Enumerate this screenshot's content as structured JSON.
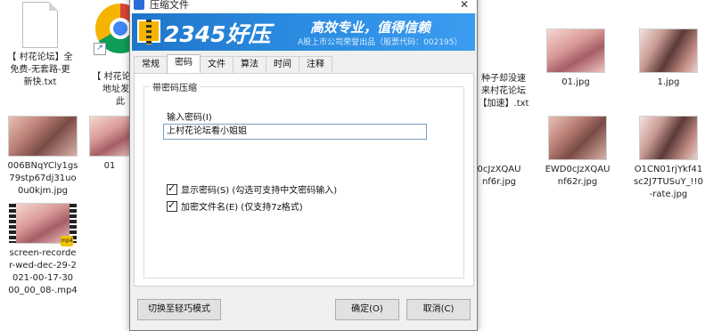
{
  "desktop": {
    "icons": [
      {
        "label": "【 村花论坛】全\n免费-无套路-更\n新快.txt"
      },
      {
        "label": "【 村花论坛】\n地址发布\n此"
      },
      {
        "label": "种子却没速\n来村花论坛\n【加速】.txt"
      },
      {
        "label": "01.jpg"
      },
      {
        "label": "1.jpg"
      },
      {
        "label": "006BNqYCly1gs\n79stp67dj31uo\n0u0kjm.jpg"
      },
      {
        "label": "01"
      },
      {
        "label": "0cJzXQAU\nnf6r.jpg"
      },
      {
        "label": "EWD0cJzXQAU\nnf62r.jpg"
      },
      {
        "label": "O1CN01rjYkf41\nsc2J7TUSuY_!!0\n-rate.jpg"
      },
      {
        "label": "screen-recorde\nr-wed-dec-29-2\n021-00-17-30\n00_00_08-.mp4"
      }
    ],
    "mp4_badge": "mp4"
  },
  "dialog": {
    "title": "压缩文件",
    "close_glyph": "✕",
    "banner": {
      "brand": "2345好压",
      "slogan": "高效专业，值得信赖",
      "sub": "A股上市公司荣誉出品（股票代码：002195）"
    },
    "tabs": [
      "常规",
      "密码",
      "文件",
      "算法",
      "时间",
      "注释"
    ],
    "active_tab": "密码",
    "group_title": "带密码压缩",
    "password_label": "输入密码(I)",
    "password_value": "上村花论坛看小姐姐",
    "show_password": {
      "label": "显示密码(S)  (勾选可支持中文密码输入)",
      "checked": true
    },
    "encrypt_names": {
      "label": "加密文件名(E)  (仅支持7z格式)",
      "checked": true
    },
    "buttons": {
      "switch_mode": "切换至轻巧模式",
      "ok": "确定(O)",
      "cancel": "取消(C)"
    }
  }
}
